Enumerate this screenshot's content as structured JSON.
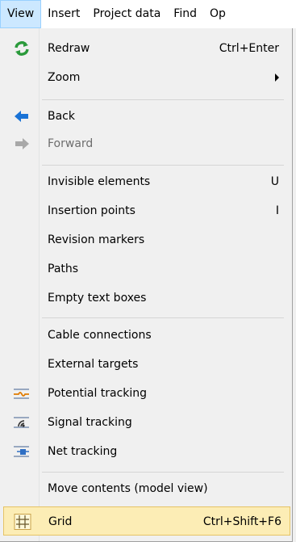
{
  "menubar": {
    "items": [
      "View",
      "Insert",
      "Project data",
      "Find",
      "Op"
    ]
  },
  "menu": {
    "redraw": {
      "label": "Redraw",
      "shortcut": "Ctrl+Enter",
      "icon": "refresh-icon"
    },
    "zoom": {
      "label": "Zoom"
    },
    "back": {
      "label": "Back",
      "icon": "back-arrow-icon"
    },
    "forward": {
      "label": "Forward",
      "icon": "forward-arrow-icon"
    },
    "invisible_elements": {
      "label": "Invisible elements",
      "shortcut": "U"
    },
    "insertion_points": {
      "label": "Insertion points",
      "shortcut": "I"
    },
    "revision_markers": {
      "label": "Revision markers"
    },
    "paths": {
      "label": "Paths"
    },
    "empty_text_boxes": {
      "label": "Empty text boxes"
    },
    "cable_connections": {
      "label": "Cable connections"
    },
    "external_targets": {
      "label": "External targets"
    },
    "potential_tracking": {
      "label": "Potential tracking",
      "icon": "potential-tracking-icon"
    },
    "signal_tracking": {
      "label": "Signal tracking",
      "icon": "signal-tracking-icon"
    },
    "net_tracking": {
      "label": "Net tracking",
      "icon": "net-tracking-icon"
    },
    "move_contents": {
      "label": "Move contents (model view)"
    },
    "grid": {
      "label": "Grid",
      "shortcut": "Ctrl+Shift+F6",
      "icon": "grid-icon"
    }
  },
  "colors": {
    "active_menubar": "#cce8ff",
    "highlight": "#fcedb5",
    "refresh_icon": "#2a9a3b",
    "back_icon": "#1a73d6"
  }
}
